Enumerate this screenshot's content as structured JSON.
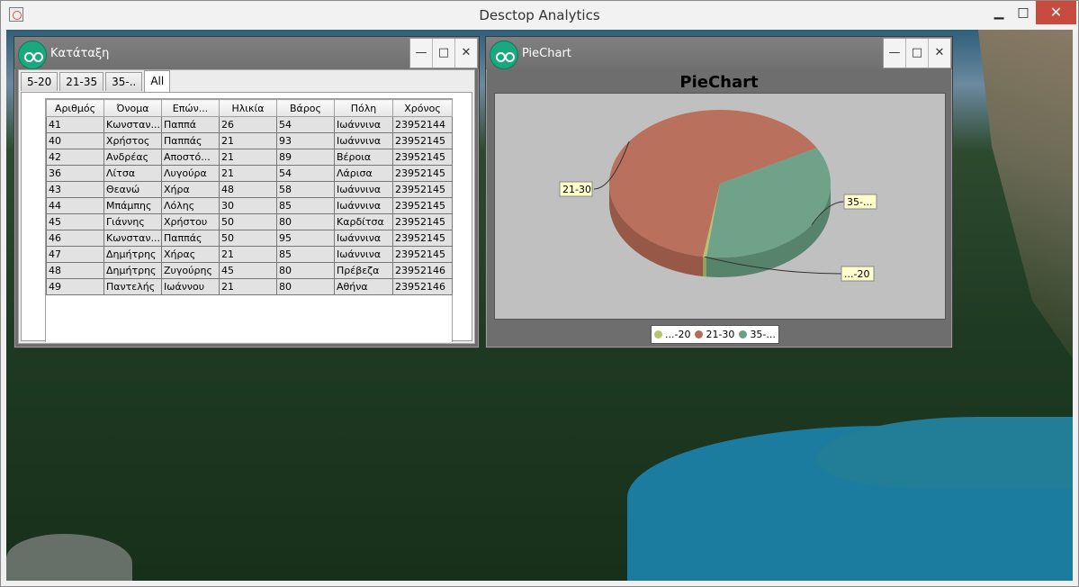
{
  "window": {
    "title": "Desctop Analytics"
  },
  "frames": {
    "ranking": {
      "title": "Κατάταξη",
      "tabs": [
        "5-20",
        "21-35",
        "35-..",
        "All"
      ],
      "active_tab": "All",
      "columns": [
        "Αριθμός",
        "Όνομα",
        "Επών...",
        "Ηλικία",
        "Βάρος",
        "Πόλη",
        "Χρόνος"
      ],
      "rows": [
        [
          "41",
          "Κωνσταν...",
          "Παππά",
          "26",
          "54",
          "Ιωάννινα",
          "23952144"
        ],
        [
          "40",
          "Χρήστος",
          "Παππάς",
          "21",
          "93",
          "Ιωάννινα",
          "23952145"
        ],
        [
          "42",
          "Ανδρέας",
          "Αποστό...",
          "21",
          "89",
          "Βέροια",
          "23952145"
        ],
        [
          "36",
          "Λίτσα",
          "Λυγούρα",
          "21",
          "54",
          "Λάρισα",
          "23952145"
        ],
        [
          "43",
          "Θεανώ",
          "Χήρα",
          "48",
          "58",
          "Ιωάννινα",
          "23952145"
        ],
        [
          "44",
          "Μπάμπης",
          "Λόλης",
          "30",
          "85",
          "Ιωάννινα",
          "23952145"
        ],
        [
          "45",
          "Γιάννης",
          "Χρήστου",
          "50",
          "80",
          "Καρδίτσα",
          "23952145"
        ],
        [
          "46",
          "Κωνσταν...",
          "Παππάς",
          "50",
          "95",
          "Ιωάννινα",
          "23952145"
        ],
        [
          "47",
          "Δημήτρης",
          "Χήρας",
          "21",
          "85",
          "Ιωάννινα",
          "23952145"
        ],
        [
          "48",
          "Δημήτρης",
          "Ζυγούρης",
          "45",
          "80",
          "Πρέβεζα",
          "23952146"
        ],
        [
          "49",
          "Παντελής",
          "Ιωάννου",
          "21",
          "80",
          "Αθήνα",
          "23952146"
        ]
      ]
    },
    "piechart": {
      "title": "PieChart"
    }
  },
  "chart_data": {
    "type": "pie",
    "title": "PieChart",
    "categories": [
      "...-20",
      "21-30",
      "35-..."
    ],
    "values": [
      0.5,
      64.5,
      35
    ],
    "colors": [
      "#b5c46e",
      "#b86b56",
      "#6aa085"
    ],
    "slice_labels": [
      "...-20",
      "21-30",
      "35-..."
    ],
    "legend_placement": "bottom"
  }
}
